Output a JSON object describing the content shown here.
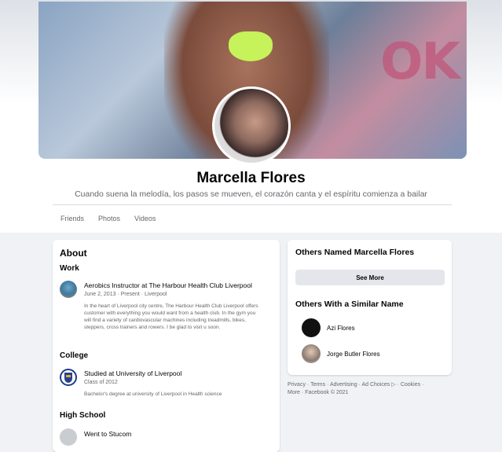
{
  "profile": {
    "name": "Marcella Flores",
    "bio": "Cuando suena la melodía, los pasos se mueven, el corazón canta y el espíritu comienza a bailar"
  },
  "tabs": [
    "Friends",
    "Photos",
    "Videos"
  ],
  "cover": {
    "graffiti_text": "OK"
  },
  "about": {
    "title": "About",
    "work": {
      "heading": "Work",
      "title": "Aerobics Instructor at The Harbour Health Club Liverpool",
      "meta": "June 2, 2013 · Present · Liverpool",
      "description": "In the heart of Liverpool city centre, The Harbour Health Club Liverpool offers customer with everything you would want from a health club. In the gym you will find a variety of cardiovascular machines including treadmills, bikes, steppers, cross trainers and rowers. I be glad to visit u soon."
    },
    "college": {
      "heading": "College",
      "title": "Studied at University of Liverpool",
      "meta": "Class of 2012",
      "description": "Bachelor's degree at university of Liverpool in Health science"
    },
    "high_school": {
      "heading": "High School",
      "title": "Went to Stucom"
    }
  },
  "others": {
    "named_title": "Others Named Marcella Flores",
    "see_more": "See More",
    "similar_title": "Others With a Similar Name",
    "people": [
      {
        "name": "Azi Flores"
      },
      {
        "name": "Jorge Butler Flores"
      }
    ]
  },
  "footer": {
    "privacy": "Privacy",
    "terms": "Terms",
    "advertising": "Advertising",
    "ad_choices": "Ad Choices ▷",
    "cookies": "Cookies",
    "more": "More",
    "copyright": "Facebook © 2021",
    "sep": " · "
  },
  "colors": {
    "text": "#050505",
    "secondary": "#65676b",
    "background": "#f0f2f5",
    "button": "#e4e6eb"
  }
}
